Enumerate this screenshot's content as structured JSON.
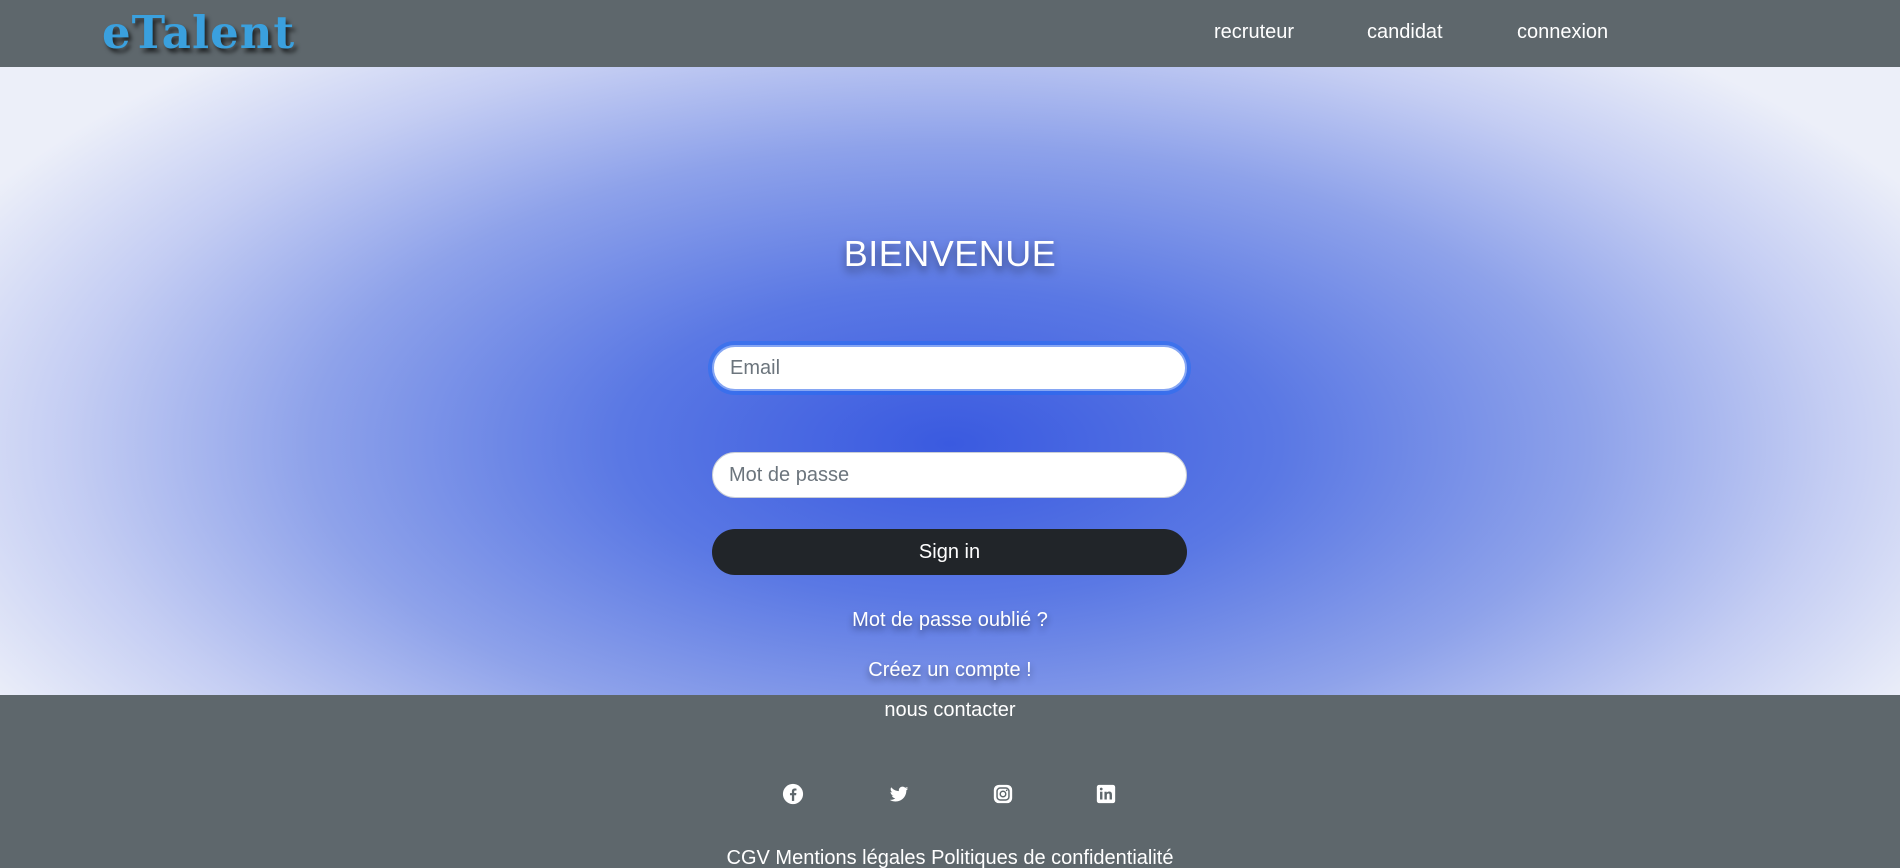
{
  "brand": {
    "logo": "eTalent",
    "logo_color": "#3aa0de"
  },
  "nav": {
    "recruteur": "recruteur",
    "candidat": "candidat",
    "connexion": "connexion"
  },
  "login": {
    "title": "BIENVENUE",
    "email_placeholder": "Email",
    "email_value": "",
    "password_placeholder": "Mot de passe",
    "password_value": "",
    "signin_label": "Sign in",
    "forgot_link": "Mot de passe oublié ?",
    "create_link": "Créez un compte !"
  },
  "footer": {
    "contact": "nous contacter",
    "social_icons": [
      "facebook-icon",
      "twitter-icon",
      "instagram-icon",
      "linkedin-icon"
    ],
    "legal": {
      "cgv": "CGV",
      "mentions": "Mentions légales",
      "privacy": "Politiques de confidentialité"
    }
  },
  "colors": {
    "bar": "#5e676c",
    "hero_center": "#3a5ae0",
    "button": "#212529"
  }
}
